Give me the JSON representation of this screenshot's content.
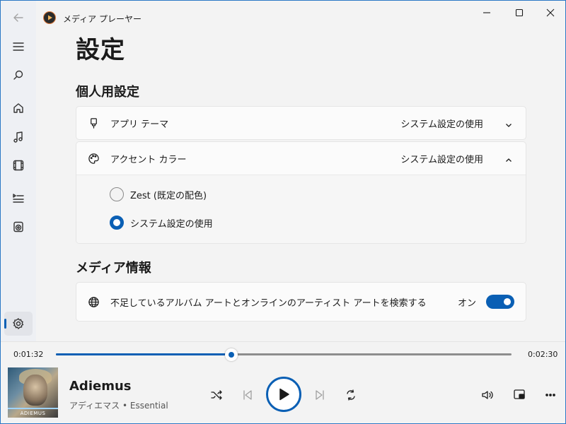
{
  "window": {
    "app_title": "メディア プレーヤー",
    "accent_color": "#0a5fb4"
  },
  "rail": {
    "items": [
      {
        "name": "back-arrow-icon",
        "state": "disabled"
      },
      {
        "name": "hamburger-menu-icon"
      },
      {
        "name": "search-icon"
      },
      {
        "name": "home-icon"
      },
      {
        "name": "music-note-icon"
      },
      {
        "name": "film-icon"
      },
      {
        "name": "playlist-icon"
      },
      {
        "name": "play-queue-icon"
      },
      {
        "name": "gear-icon",
        "state": "active"
      }
    ]
  },
  "page": {
    "title": "設定",
    "personal_section": "個人用設定",
    "media_section": "メディア情報"
  },
  "settings": {
    "app_theme": {
      "label": "アプリ テーマ",
      "value": "システム設定の使用",
      "icon": "brush-icon",
      "expanded": false
    },
    "accent_color": {
      "label": "アクセント カラー",
      "value": "システム設定の使用",
      "icon": "palette-icon",
      "expanded": true,
      "options": [
        {
          "label": "Zest (既定の配色)",
          "checked": false
        },
        {
          "label": "システム設定の使用",
          "checked": true
        }
      ]
    },
    "media_info": {
      "label": "不足しているアルバム アートとオンラインのアーティスト アートを検索する",
      "toggle_label": "オン",
      "toggle_on": true,
      "icon": "globe-icon"
    }
  },
  "player": {
    "elapsed": "0:01:32",
    "total": "0:02:30",
    "progress_fraction": 0.385,
    "track_title": "Adiemus",
    "track_subtitle": "アディエマス • Essential",
    "album_art_text": "ADIEMUS"
  }
}
